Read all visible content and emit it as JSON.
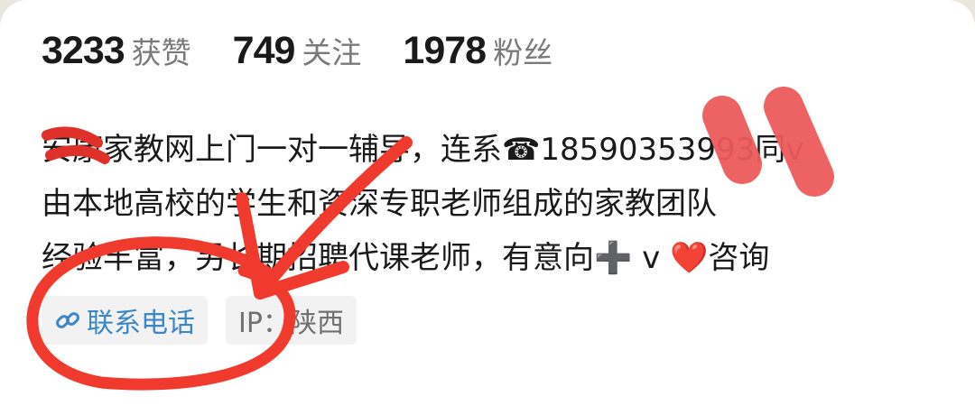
{
  "stats": [
    {
      "value": "3233",
      "label": "获赞"
    },
    {
      "value": "749",
      "label": "关注"
    },
    {
      "value": "1978",
      "label": "粉丝"
    }
  ],
  "bio": {
    "line1": "安康家教网上门一对一辅导，连系☎18590353993同v",
    "line2": "由本地高校的学生和资深专职老师组成的家教团队",
    "line3": "经验丰富，另长期招聘代课老师，有意向➕ v ❤️咨询"
  },
  "tags": {
    "contact_label": "联系电话",
    "ip_label": "IP：陕西"
  },
  "icons": {
    "contact": "link-icon"
  },
  "colors": {
    "annotation_red": "#f03a2e",
    "link_blue": "#3a86c8"
  }
}
